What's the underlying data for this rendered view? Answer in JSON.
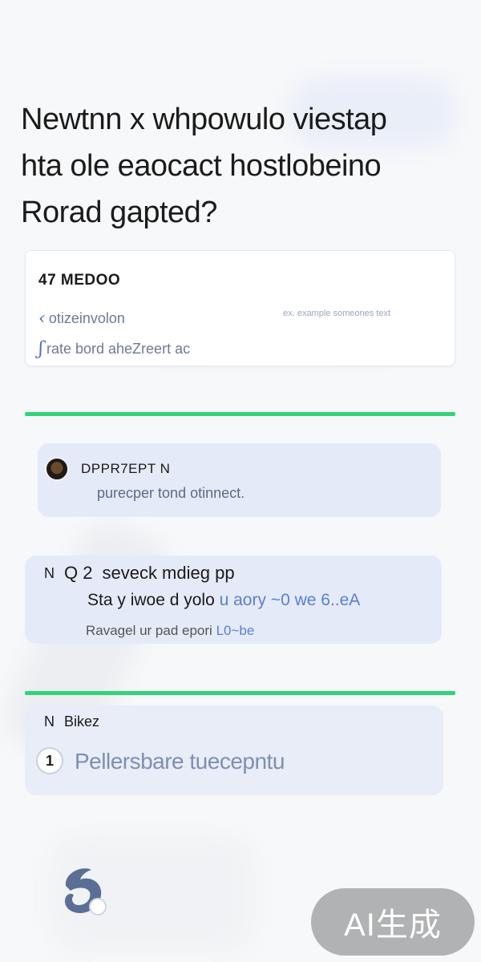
{
  "question": {
    "lines": [
      "Newtnn x whpowulo viestap",
      "hta ole eaocact hostlobeino",
      "Rorad gapted?"
    ]
  },
  "top_card": {
    "heading": "47 MEDOO",
    "row1": "otizeinvolon",
    "row2": "rate bord aheZreert ac",
    "hint": "ex. example someones text"
  },
  "answers": [
    {
      "name": "DPPR7EPT N",
      "body": "purecper tond otinnect."
    },
    {
      "meta_left": "N",
      "meta_count": "Q 2",
      "meta_title": "seveck mdieg pp",
      "line1_text": "Sta y iwoe d yolo",
      "line1_link": "u aory ~0 we 6..eA",
      "line2_text": "Ravagel ur pad epori",
      "line2_link": "L0~be"
    },
    {
      "meta_left": "N",
      "meta_title": "Bikez",
      "badge": "1",
      "line": "Pellersbare tuecepntu"
    }
  ],
  "watermark": "AI生成",
  "icons": {
    "quote": "quote-icon",
    "avatar": "user-avatar",
    "mascot": "mascot-icon"
  },
  "colors": {
    "accent_green": "#34d27a",
    "answer_bg": "#e4eaf8",
    "link_blue": "#5a7fd6"
  }
}
